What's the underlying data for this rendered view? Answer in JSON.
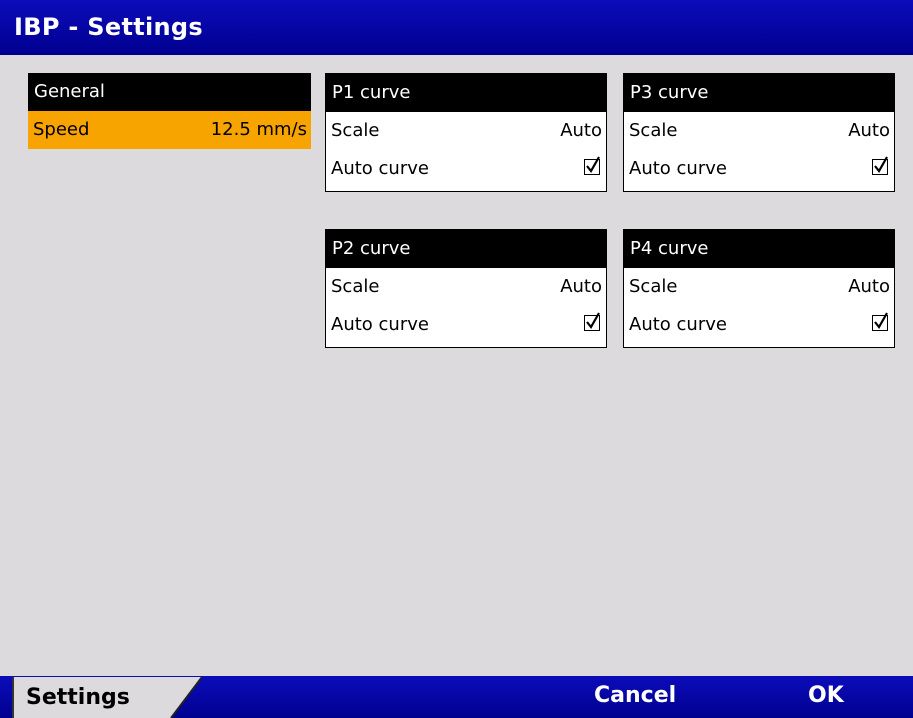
{
  "window": {
    "title": "IBP - Settings"
  },
  "general": {
    "header": "General",
    "speed_label": "Speed",
    "speed_value": "12.5 mm/s"
  },
  "curves": {
    "p1": {
      "header": "P1 curve",
      "scale_label": "Scale",
      "scale_value": "Auto",
      "auto_label": "Auto curve",
      "auto_checked": true
    },
    "p2": {
      "header": "P2 curve",
      "scale_label": "Scale",
      "scale_value": "Auto",
      "auto_label": "Auto curve",
      "auto_checked": true
    },
    "p3": {
      "header": "P3 curve",
      "scale_label": "Scale",
      "scale_value": "Auto",
      "auto_label": "Auto curve",
      "auto_checked": true
    },
    "p4": {
      "header": "P4 curve",
      "scale_label": "Scale",
      "scale_value": "Auto",
      "auto_label": "Auto curve",
      "auto_checked": true
    }
  },
  "bottom": {
    "tab_label": "Settings",
    "cancel_label": "Cancel",
    "ok_label": "OK"
  },
  "colors": {
    "title_bar": "#00008f",
    "background": "#dcdadd",
    "highlight": "#f7a400"
  }
}
